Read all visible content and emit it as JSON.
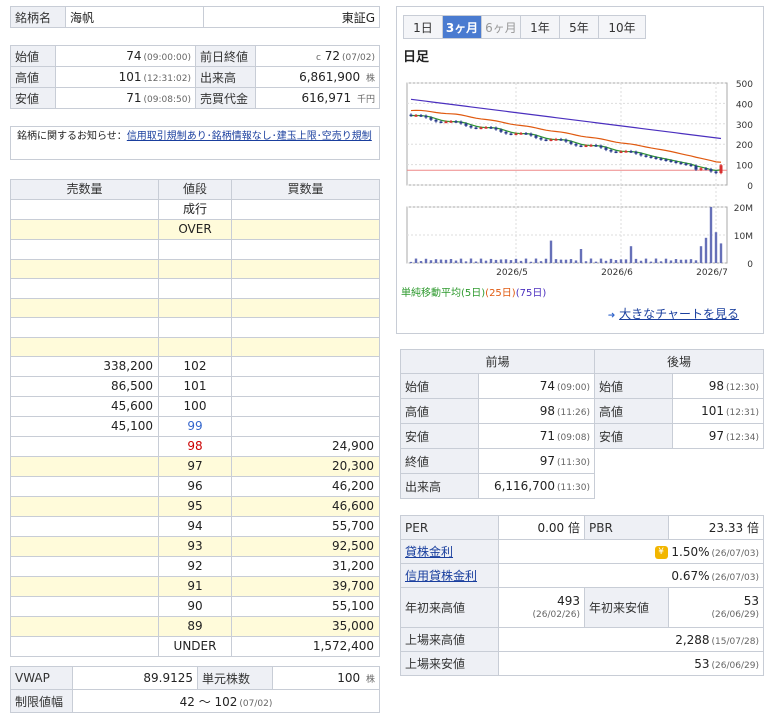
{
  "header": {
    "name_label": "銘柄名",
    "name": "海帆",
    "market": "東証G"
  },
  "prices": {
    "open_label": "始値",
    "open": "74",
    "open_time": "(09:00:00)",
    "prev_label": "前日終値",
    "prev_mark": "c",
    "prev": "72",
    "prev_date": "(07/02)",
    "high_label": "高値",
    "high": "101",
    "high_time": "(12:31:02)",
    "vol_label": "出来高",
    "vol": "6,861,900",
    "vol_unit": "株",
    "low_label": "安値",
    "low": "71",
    "low_time": "(09:08:50)",
    "turn_label": "売買代金",
    "turn": "616,971",
    "turn_unit": "千円"
  },
  "notice": {
    "label": "銘柄に関するお知らせ：",
    "link": "信用取引規制あり･銘柄情報なし･建玉上限･空売り規制"
  },
  "board": {
    "headers": [
      "売数量",
      "値段",
      "買数量"
    ],
    "rows": [
      {
        "sell": "",
        "price": "成行",
        "buy": ""
      },
      {
        "sell": "",
        "price": "OVER",
        "buy": ""
      },
      {
        "sell": "",
        "price": "",
        "buy": ""
      },
      {
        "sell": "",
        "price": "",
        "buy": ""
      },
      {
        "sell": "",
        "price": "",
        "buy": ""
      },
      {
        "sell": "",
        "price": "",
        "buy": ""
      },
      {
        "sell": "",
        "price": "",
        "buy": ""
      },
      {
        "sell": "",
        "price": "",
        "buy": ""
      },
      {
        "sell": "338,200",
        "price": "102",
        "buy": ""
      },
      {
        "sell": "86,500",
        "price": "101",
        "buy": ""
      },
      {
        "sell": "45,600",
        "price": "100",
        "buy": ""
      },
      {
        "sell": "45,100",
        "price": "99",
        "buy": ""
      },
      {
        "sell": "",
        "price": "98",
        "buy": "24,900"
      },
      {
        "sell": "",
        "price": "97",
        "buy": "20,300"
      },
      {
        "sell": "",
        "price": "96",
        "buy": "46,200"
      },
      {
        "sell": "",
        "price": "95",
        "buy": "46,600"
      },
      {
        "sell": "",
        "price": "94",
        "buy": "55,700"
      },
      {
        "sell": "",
        "price": "93",
        "buy": "92,500"
      },
      {
        "sell": "",
        "price": "92",
        "buy": "31,200"
      },
      {
        "sell": "",
        "price": "91",
        "buy": "39,700"
      },
      {
        "sell": "",
        "price": "90",
        "buy": "55,100"
      },
      {
        "sell": "",
        "price": "89",
        "buy": "35,000"
      },
      {
        "sell": "",
        "price": "UNDER",
        "buy": "1,572,400"
      }
    ]
  },
  "vwap": {
    "label": "VWAP",
    "value": "89.9125",
    "unit_label": "単元株数",
    "unit": "100",
    "unit_suffix": "株",
    "limit_label": "制限値幅",
    "limit": "42 ～ 102",
    "limit_date": "(07/02)"
  },
  "chart": {
    "tabs": [
      "1日",
      "3ヶ月",
      "6ヶ月",
      "1年",
      "5年",
      "10年"
    ],
    "active_tab": "3ヶ月",
    "title": "日足",
    "price_ticks": [
      "500",
      "400",
      "300",
      "200",
      "100",
      "0"
    ],
    "vol_ticks": [
      "20M",
      "10M",
      "0"
    ],
    "x_ticks": [
      "2026/5",
      "2026/6",
      "2026/7"
    ],
    "ma_label": "単純移動平均",
    "ma5": "(5日)",
    "ma25": "(25日)",
    "ma75": "(75日)",
    "big_link": "大きなチャートを見る",
    "colors": {
      "ma5": "#2e9a2e",
      "ma25": "#e05a10",
      "ma75": "#4b2fbf",
      "up": "#d83030",
      "down": "#2a3c8c",
      "vol": "#6670b8",
      "close_line": "#e88"
    }
  },
  "session": {
    "headers": [
      "前場",
      "後場"
    ],
    "rows": [
      {
        "l1": "始値",
        "v1": "74",
        "t1": "(09:00)",
        "l2": "始値",
        "v2": "98",
        "t2": "(12:30)"
      },
      {
        "l1": "高値",
        "v1": "98",
        "t1": "(11:26)",
        "l2": "高値",
        "v2": "101",
        "t2": "(12:31)"
      },
      {
        "l1": "安値",
        "v1": "71",
        "t1": "(09:08)",
        "l2": "安値",
        "v2": "97",
        "t2": "(12:34)"
      },
      {
        "l1": "終値",
        "v1": "97",
        "t1": "(11:30)"
      },
      {
        "l1": "出来高",
        "v1": "6,116,700",
        "t1": "(11:30)"
      }
    ]
  },
  "indicators": {
    "per_label": "PER",
    "per": "0.00",
    "per_unit": "倍",
    "pbr_label": "PBR",
    "pbr": "23.33",
    "pbr_unit": "倍",
    "lend_label": "貸株金利",
    "lend": "1.50%",
    "lend_date": "(26/07/03)",
    "marg_label": "信用貸株金利",
    "marg": "0.67%",
    "marg_date": "(26/07/03)",
    "ytdh_label": "年初来高値",
    "ytdh": "493",
    "ytdh_date": "(26/02/26)",
    "ytdl_label": "年初来安値",
    "ytdl": "53",
    "ytdl_date": "(26/06/29)",
    "lh_label": "上場来高値",
    "lh": "2,288",
    "lh_date": "(15/07/28)",
    "ll_label": "上場来安値",
    "ll": "53",
    "ll_date": "(26/06/29)"
  }
}
